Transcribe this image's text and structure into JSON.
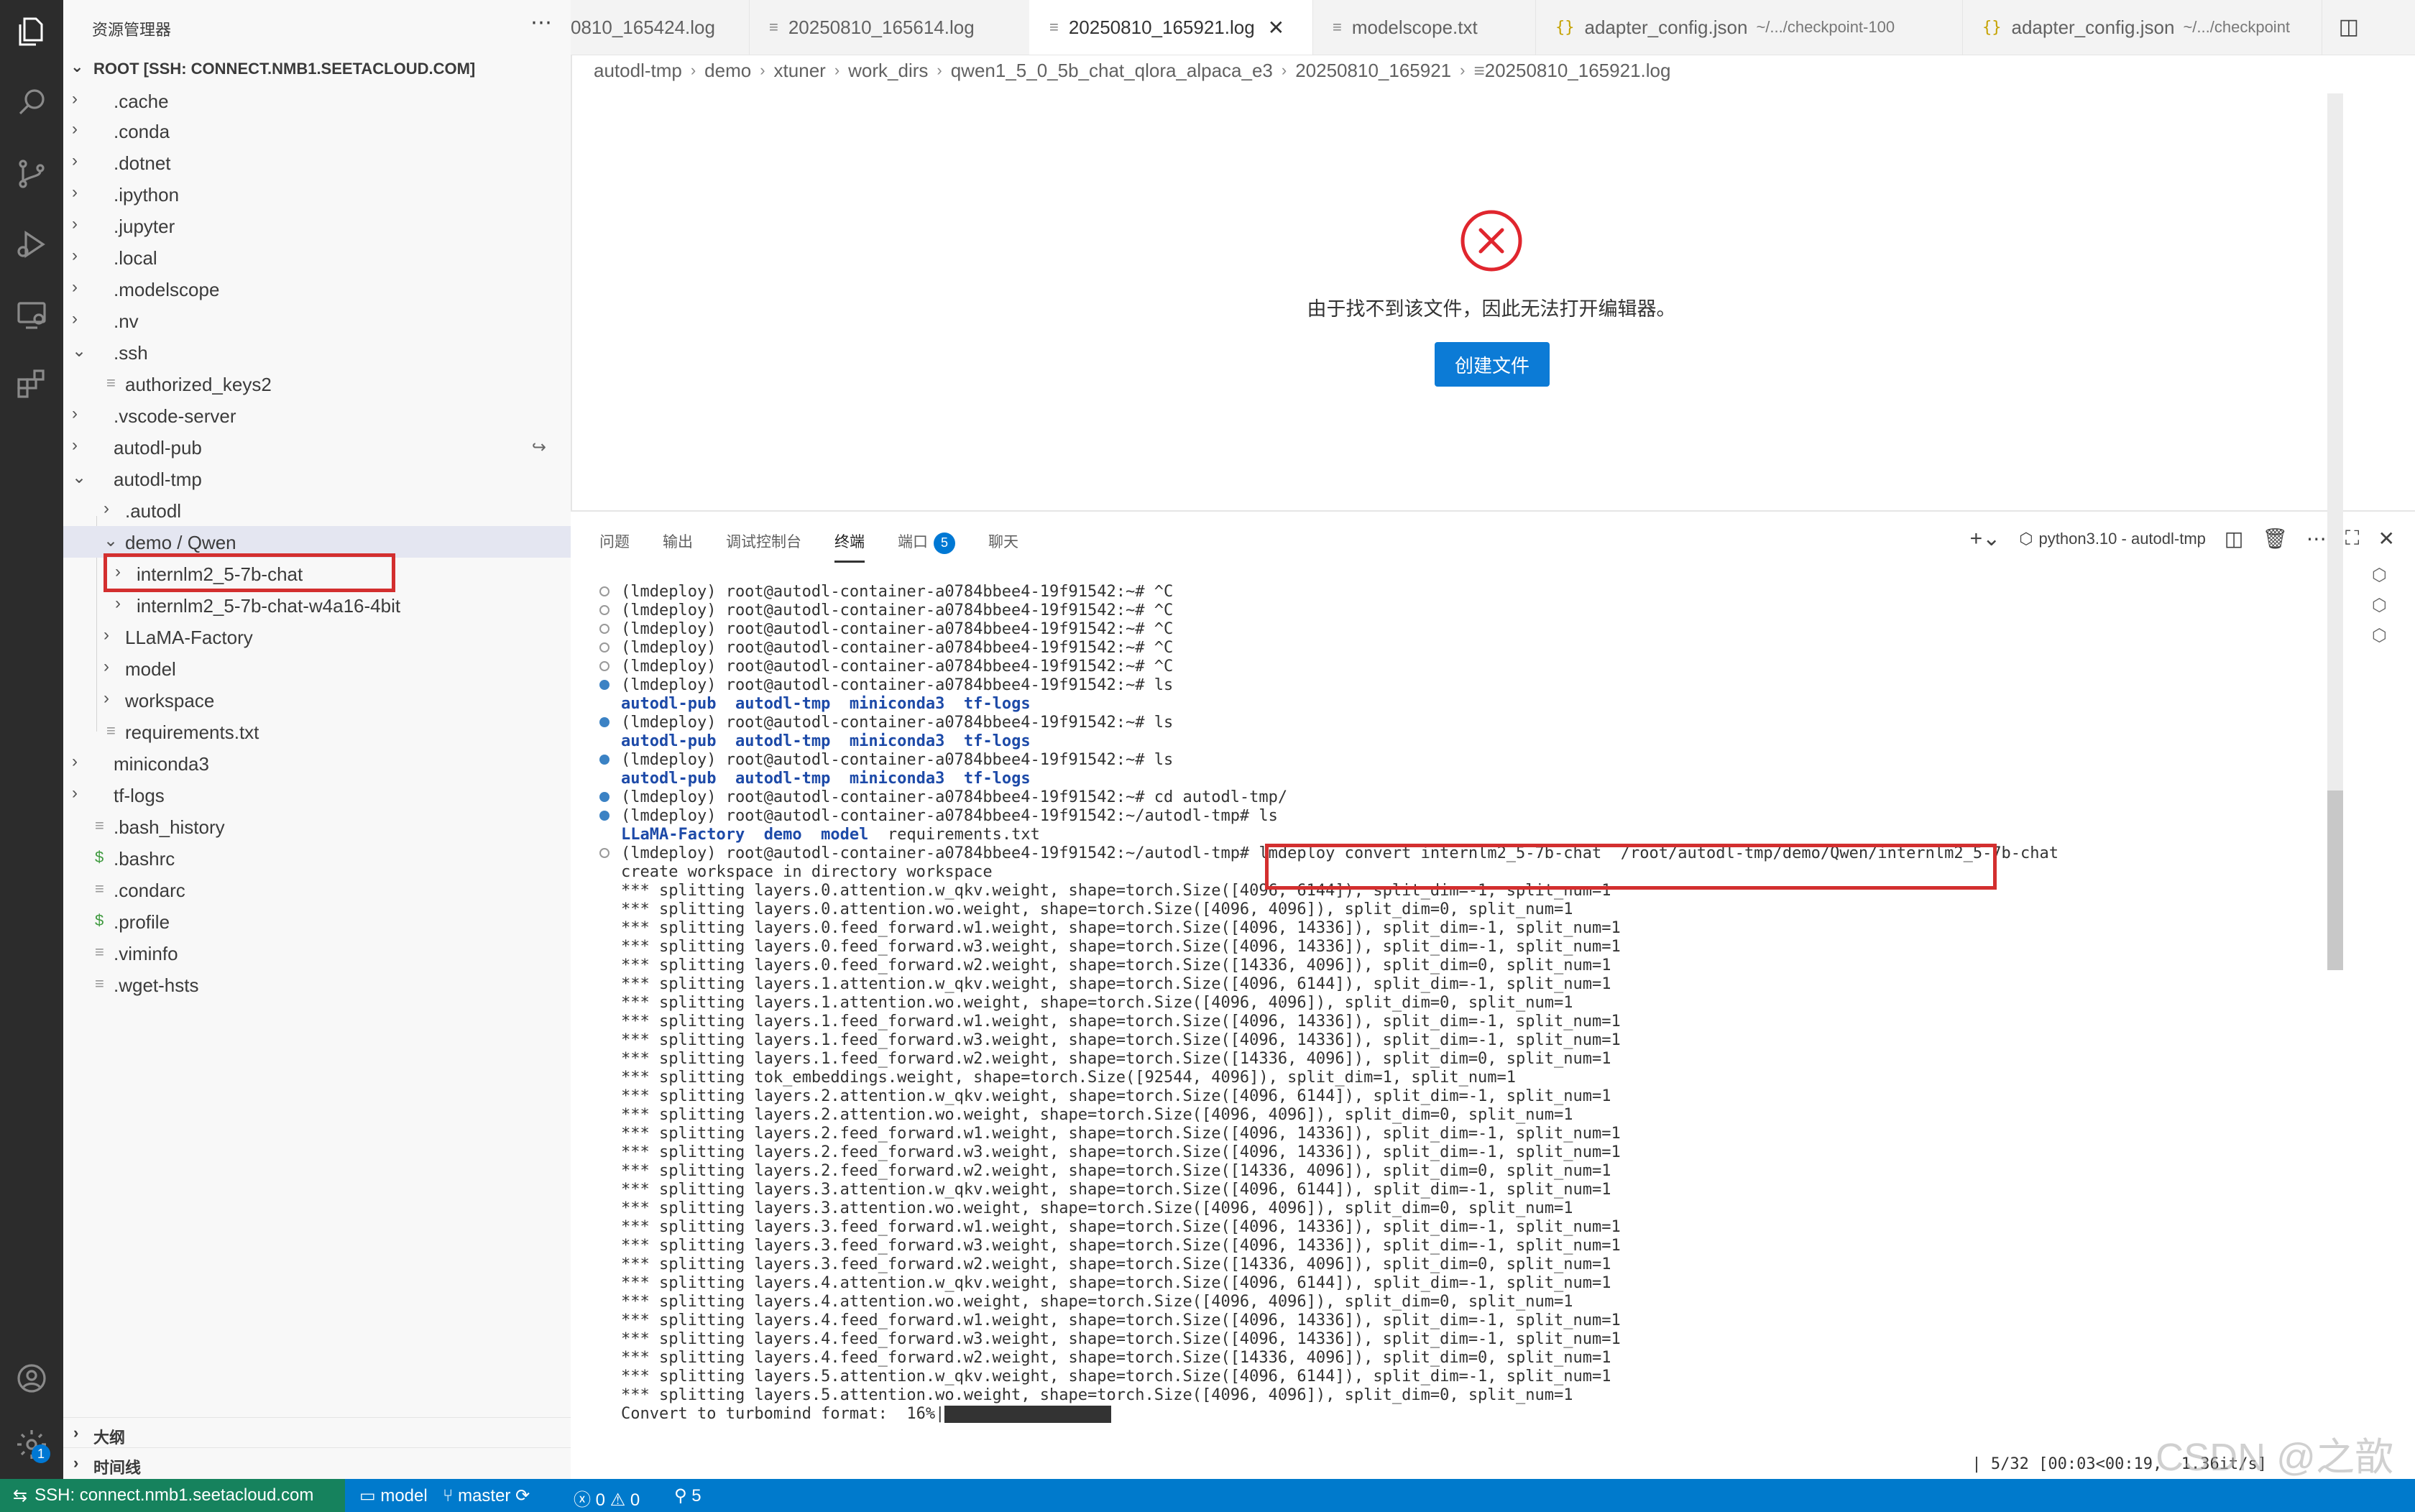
{
  "sidebar": {
    "title": "资源管理器",
    "more": "⋯",
    "root": "ROOT [SSH: CONNECT.NMB1.SEETACLOUD.COM]",
    "items": [
      {
        "label": ".cache"
      },
      {
        "label": ".conda"
      },
      {
        "label": ".dotnet"
      },
      {
        "label": ".ipython"
      },
      {
        "label": ".jupyter"
      },
      {
        "label": ".local"
      },
      {
        "label": ".modelscope"
      },
      {
        "label": ".nv"
      },
      {
        "label": ".ssh"
      },
      {
        "label": "authorized_keys2"
      },
      {
        "label": ".vscode-server"
      },
      {
        "label": "autodl-pub"
      },
      {
        "label": "autodl-tmp"
      },
      {
        "label": ".autodl"
      },
      {
        "label": "demo / Qwen"
      },
      {
        "label": "internlm2_5-7b-chat"
      },
      {
        "label": "internlm2_5-7b-chat-w4a16-4bit"
      },
      {
        "label": "LLaMA-Factory"
      },
      {
        "label": "model"
      },
      {
        "label": "workspace"
      },
      {
        "label": "requirements.txt"
      },
      {
        "label": "miniconda3"
      },
      {
        "label": "tf-logs"
      },
      {
        "label": ".bash_history"
      },
      {
        "label": ".bashrc"
      },
      {
        "label": ".condarc"
      },
      {
        "label": ".profile"
      },
      {
        "label": ".viminfo"
      },
      {
        "label": ".wget-hsts"
      }
    ],
    "outline": "大纲",
    "timeline": "时间线"
  },
  "tabs": [
    {
      "label": "0810_165424.log"
    },
    {
      "label": "20250810_165614.log"
    },
    {
      "label": "20250810_165921.log"
    },
    {
      "label": "modelscope.txt"
    },
    {
      "label": "adapter_config.json",
      "desc": "~/.../checkpoint-100"
    },
    {
      "label": "adapter_config.json",
      "desc": "~/.../checkpoint"
    }
  ],
  "breadcrumb": [
    "autodl-tmp",
    "demo",
    "xtuner",
    "work_dirs",
    "qwen1_5_0_5b_chat_qlora_alpaca_e3",
    "20250810_165921",
    "20250810_165921.log"
  ],
  "editor": {
    "error_message": "由于找不到该文件，因此无法打开编辑器。",
    "create_button": "创建文件"
  },
  "panel": {
    "tabs": [
      "问题",
      "输出",
      "调试控制台",
      "终端",
      "端口",
      "聊天"
    ],
    "ports_count": "5",
    "terminal_name": "python3.10 - autodl-tmp"
  },
  "terminal": {
    "prompt_home": "(lmdeploy) root@autodl-container-a0784bbee4-19f91542:~#",
    "prompt_tmp": "(lmdeploy) root@autodl-container-a0784bbee4-19f91542:~/autodl-tmp#",
    "ctrl_c": " ^C",
    "ls": " ls",
    "cd": " cd autodl-tmp/",
    "home_dirs": [
      "autodl-pub",
      "autodl-tmp",
      "miniconda3",
      "tf-logs"
    ],
    "tmp_dirs": [
      "LLaMA-Factory",
      "demo",
      "model"
    ],
    "tmp_file": "requirements.txt",
    "convert_cmd": "lmdeploy convert internlm2_5-7b-chat  /root/autodl-tmp/demo/Qwen/internlm2_5-7b-chat",
    "create_ws": "create workspace in directory workspace",
    "split_lines": [
      "*** splitting layers.0.attention.w_qkv.weight, shape=torch.Size([4096, 6144]), split_dim=-1, split_num=1",
      "*** splitting layers.0.attention.wo.weight, shape=torch.Size([4096, 4096]), split_dim=0, split_num=1",
      "*** splitting layers.0.feed_forward.w1.weight, shape=torch.Size([4096, 14336]), split_dim=-1, split_num=1",
      "*** splitting layers.0.feed_forward.w3.weight, shape=torch.Size([4096, 14336]), split_dim=-1, split_num=1",
      "*** splitting layers.0.feed_forward.w2.weight, shape=torch.Size([14336, 4096]), split_dim=0, split_num=1",
      "*** splitting layers.1.attention.w_qkv.weight, shape=torch.Size([4096, 6144]), split_dim=-1, split_num=1",
      "*** splitting layers.1.attention.wo.weight, shape=torch.Size([4096, 4096]), split_dim=0, split_num=1",
      "*** splitting layers.1.feed_forward.w1.weight, shape=torch.Size([4096, 14336]), split_dim=-1, split_num=1",
      "*** splitting layers.1.feed_forward.w3.weight, shape=torch.Size([4096, 14336]), split_dim=-1, split_num=1",
      "*** splitting layers.1.feed_forward.w2.weight, shape=torch.Size([14336, 4096]), split_dim=0, split_num=1",
      "*** splitting tok_embeddings.weight, shape=torch.Size([92544, 4096]), split_dim=1, split_num=1",
      "*** splitting layers.2.attention.w_qkv.weight, shape=torch.Size([4096, 6144]), split_dim=-1, split_num=1",
      "*** splitting layers.2.attention.wo.weight, shape=torch.Size([4096, 4096]), split_dim=0, split_num=1",
      "*** splitting layers.2.feed_forward.w1.weight, shape=torch.Size([4096, 14336]), split_dim=-1, split_num=1",
      "*** splitting layers.2.feed_forward.w3.weight, shape=torch.Size([4096, 14336]), split_dim=-1, split_num=1",
      "*** splitting layers.2.feed_forward.w2.weight, shape=torch.Size([14336, 4096]), split_dim=0, split_num=1",
      "*** splitting layers.3.attention.w_qkv.weight, shape=torch.Size([4096, 6144]), split_dim=-1, split_num=1",
      "*** splitting layers.3.attention.wo.weight, shape=torch.Size([4096, 4096]), split_dim=0, split_num=1",
      "*** splitting layers.3.feed_forward.w1.weight, shape=torch.Size([4096, 14336]), split_dim=-1, split_num=1",
      "*** splitting layers.3.feed_forward.w3.weight, shape=torch.Size([4096, 14336]), split_dim=-1, split_num=1",
      "*** splitting layers.3.feed_forward.w2.weight, shape=torch.Size([14336, 4096]), split_dim=0, split_num=1",
      "*** splitting layers.4.attention.w_qkv.weight, shape=torch.Size([4096, 6144]), split_dim=-1, split_num=1",
      "*** splitting layers.4.attention.wo.weight, shape=torch.Size([4096, 4096]), split_dim=0, split_num=1",
      "*** splitting layers.4.feed_forward.w1.weight, shape=torch.Size([4096, 14336]), split_dim=-1, split_num=1",
      "*** splitting layers.4.feed_forward.w3.weight, shape=torch.Size([4096, 14336]), split_dim=-1, split_num=1",
      "*** splitting layers.4.feed_forward.w2.weight, shape=torch.Size([14336, 4096]), split_dim=0, split_num=1",
      "*** splitting layers.5.attention.w_qkv.weight, shape=torch.Size([4096, 6144]), split_dim=-1, split_num=1",
      "*** splitting layers.5.attention.wo.weight, shape=torch.Size([4096, 4096]), split_dim=0, split_num=1"
    ],
    "progress_label": "Convert to turbomind format:  16%|",
    "progress_fraction": 0.16,
    "progress_right": "| 5/32 [00:03<00:19,  1.36it/s]"
  },
  "status_bar": {
    "remote": "SSH: connect.nmb1.seetacloud.com",
    "env": "model",
    "branch": "master",
    "errors": "0",
    "warnings": "0",
    "ports": "5"
  },
  "watermark": "CSDN @之歆",
  "colors": {
    "accent": "#007acc",
    "remote": "#16825d",
    "highlight": "#d32f2f",
    "button": "#0c7bd6"
  }
}
